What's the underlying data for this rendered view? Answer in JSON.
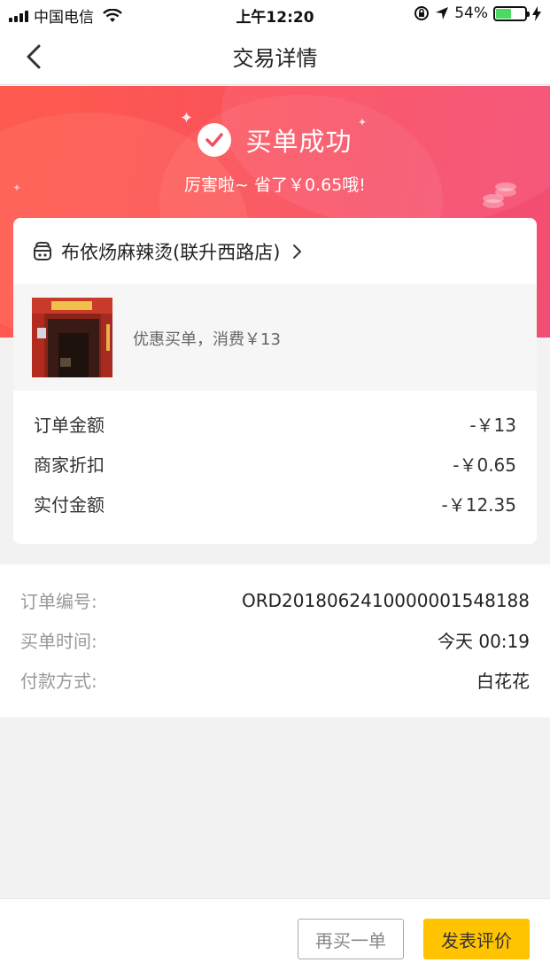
{
  "status_bar": {
    "carrier": "中国电信",
    "time": "上午12:20",
    "battery": "54%",
    "battery_level": 0.54
  },
  "nav": {
    "title": "交易详情"
  },
  "hero": {
    "status": "买单成功",
    "saved_text": "厉害啦~ 省了￥0.65哦!"
  },
  "store": {
    "name": "布依炀麻辣烫(联升西路店)"
  },
  "product": {
    "description": "优惠买单，消费￥13"
  },
  "amounts": [
    {
      "label": "订单金额",
      "value": "-￥13"
    },
    {
      "label": "商家折扣",
      "value": "-￥0.65"
    },
    {
      "label": "实付金额",
      "value": "-￥12.35"
    }
  ],
  "order_info": [
    {
      "label": "订单编号:",
      "value": "ORD2018062410000001548188"
    },
    {
      "label": "买单时间:",
      "value": "今天  00:19"
    },
    {
      "label": "付款方式:",
      "value": "白花花"
    }
  ],
  "actions": {
    "buy_again": "再买一单",
    "review": "发表评价"
  },
  "colors": {
    "hero_start": "#ff5a4e",
    "hero_end": "#f24d74",
    "review_button": "#ffc300"
  }
}
